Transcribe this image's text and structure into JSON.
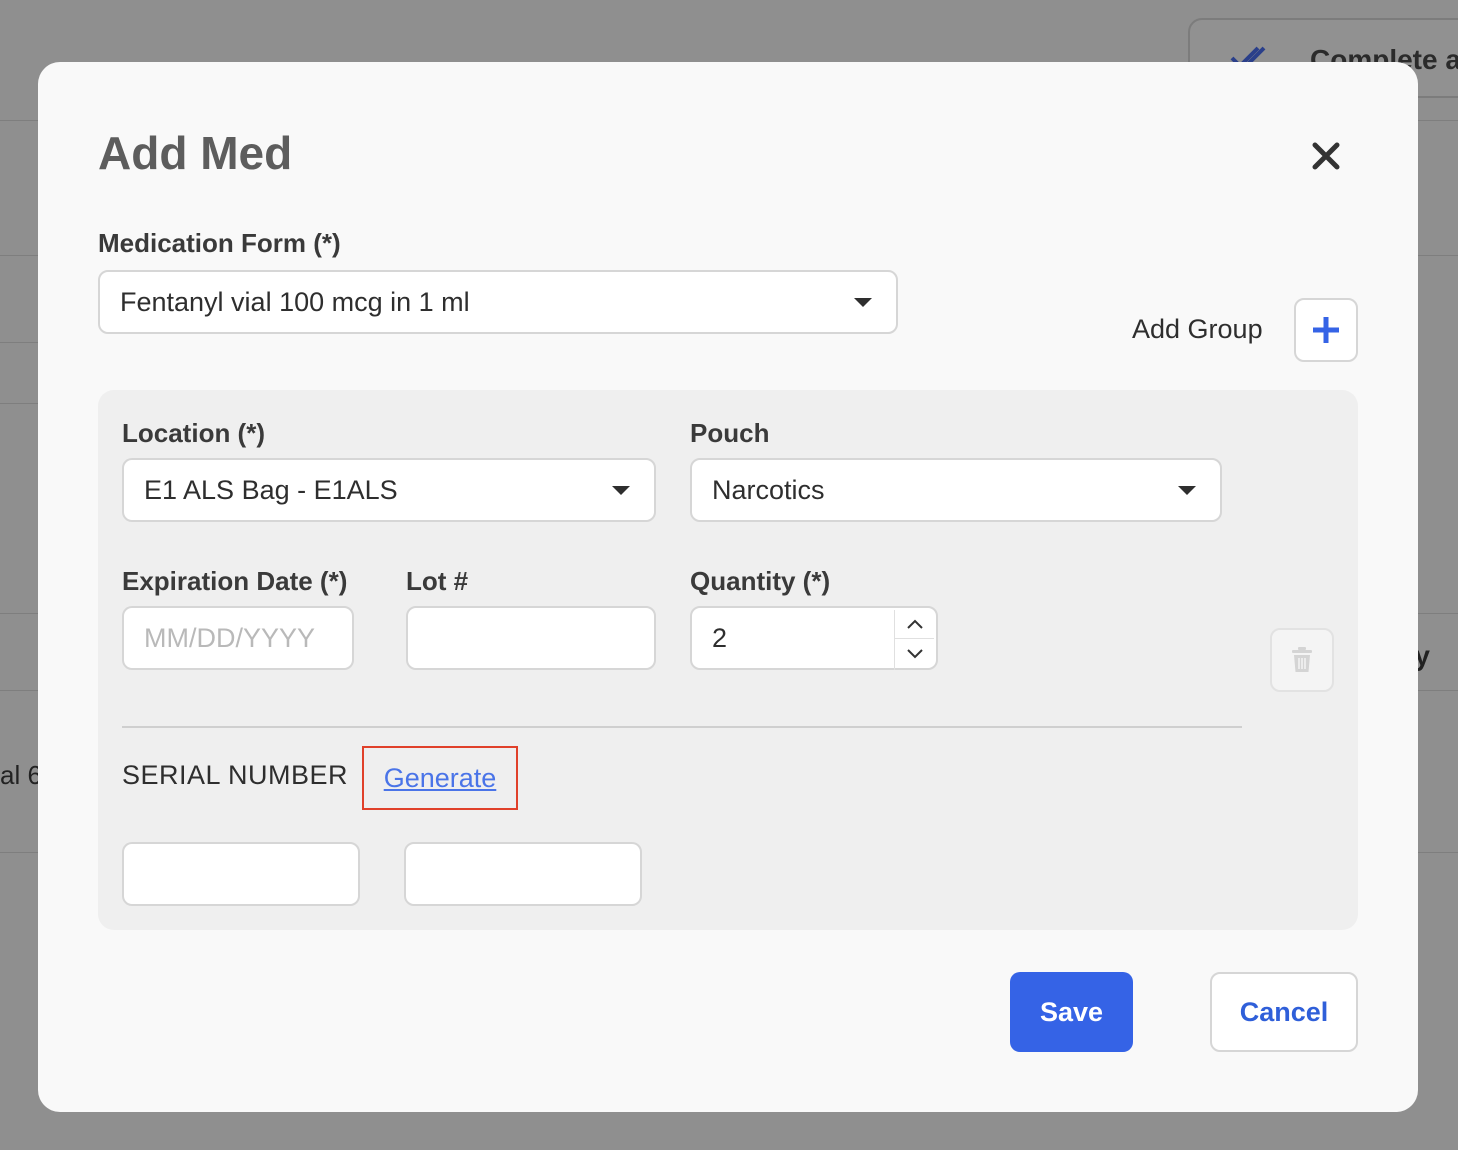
{
  "background": {
    "top_button_label": "Complete ar",
    "right_partial_text": "ty",
    "left_partial_text": "al 6"
  },
  "modal": {
    "title": "Add Med",
    "medication_form": {
      "label": "Medication Form (*)",
      "value": "Fentanyl vial 100 mcg in 1 ml"
    },
    "add_group": {
      "label": "Add Group"
    },
    "group": {
      "location": {
        "label": "Location (*)",
        "value": "E1 ALS Bag - E1ALS"
      },
      "pouch": {
        "label": "Pouch",
        "value": "Narcotics"
      },
      "expiration_date": {
        "label": "Expiration Date (*)",
        "placeholder": "MM/DD/YYYY",
        "value": ""
      },
      "lot": {
        "label": "Lot #",
        "value": ""
      },
      "quantity": {
        "label": "Quantity (*)",
        "value": "2"
      },
      "serial_number": {
        "label": "SERIAL NUMBER",
        "generate_link": "Generate",
        "fields": [
          "",
          ""
        ]
      }
    },
    "actions": {
      "save": "Save",
      "cancel": "Cancel"
    }
  },
  "colors": {
    "primary": "#3563e6",
    "link": "#4a74e8",
    "highlight_border": "#e0402a",
    "overlay": "#8f8f8f"
  },
  "icons": [
    "close-icon",
    "plus-icon",
    "chevron-up-icon",
    "chevron-down-icon",
    "trash-icon",
    "double-check-icon"
  ]
}
